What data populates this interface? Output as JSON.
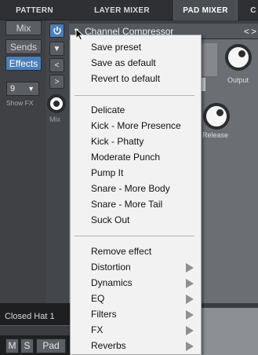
{
  "tabs": [
    {
      "label": "PATTERN"
    },
    {
      "label": "LAYER MIXER"
    },
    {
      "label": "PAD MIXER"
    },
    {
      "label": "C"
    }
  ],
  "left_panel": {
    "buttons": [
      "Mix",
      "Sends",
      "Effects"
    ],
    "active": "Effects",
    "fx_count": "9",
    "show_fx": "Show FX",
    "mix_label": "Mix"
  },
  "strip": {
    "power_icon": "power-icon",
    "down": "▼",
    "left": "<",
    "right": ">"
  },
  "effect": {
    "title": "Channel Compressor",
    "caret": "▼",
    "nav_prev": "<",
    "nav_next": ">",
    "output_label": "Output",
    "release_label": "Release"
  },
  "menu": {
    "group1": [
      "Save preset",
      "Save as default",
      "Revert to default"
    ],
    "group2": [
      "Delicate",
      "Kick - More Presence",
      "Kick - Phatty",
      "Moderate Punch",
      "Pump It",
      "Snare - More Body",
      "Snare - More Tail",
      "Suck Out"
    ],
    "group3": [
      "Remove effect",
      "Distortion",
      "Dynamics",
      "EQ",
      "Filters",
      "FX",
      "Reverbs"
    ],
    "submenus": [
      "Distortion",
      "Dynamics",
      "EQ",
      "Filters",
      "FX",
      "Reverbs"
    ]
  },
  "bottom": {
    "channel_name": "Closed Hat 1",
    "mute": "M",
    "solo": "S",
    "pad": "Pad"
  },
  "colors": {
    "accent": "#4b7fb9",
    "menu_bg": "#f2f2f2",
    "panel": "#6b6e73"
  }
}
